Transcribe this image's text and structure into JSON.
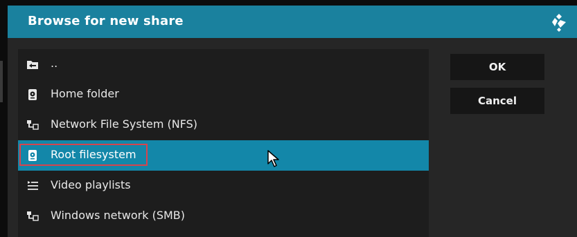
{
  "dialog": {
    "title": "Browse for new share",
    "logo_icon": "kodi-logo-icon"
  },
  "list": {
    "items": [
      {
        "label": "..",
        "icon": "parent-folder-icon",
        "focused": false
      },
      {
        "label": "Home folder",
        "icon": "drive-icon",
        "focused": false
      },
      {
        "label": "Network File System (NFS)",
        "icon": "network-icon",
        "focused": false
      },
      {
        "label": "Root filesystem",
        "icon": "drive-icon",
        "focused": true
      },
      {
        "label": "Video playlists",
        "icon": "playlist-icon",
        "focused": false
      },
      {
        "label": "Windows network (SMB)",
        "icon": "network-icon",
        "focused": false
      }
    ]
  },
  "buttons": {
    "ok_label": "OK",
    "cancel_label": "Cancel"
  },
  "colors": {
    "title_bar": "#1a819e",
    "focused_row": "#1387a9",
    "annotation_box": "#d9434c"
  }
}
